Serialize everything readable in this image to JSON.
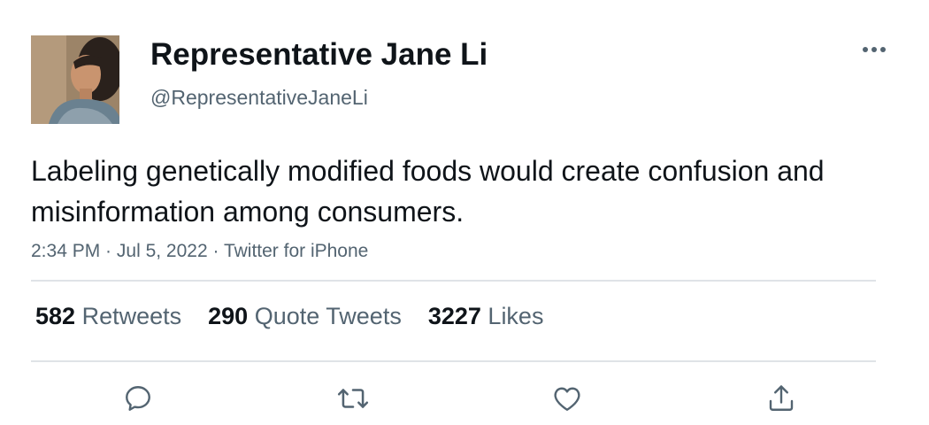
{
  "author": {
    "display_name": "Representative Jane Li",
    "handle": "@RepresentativeJaneLi"
  },
  "tweet": {
    "text": "Labeling genetically modified foods would create confusion and misinformation among consumers.",
    "time": "2:34 PM",
    "separator": " · ",
    "date": "Jul 5, 2022",
    "source": "Twitter for iPhone"
  },
  "stats": {
    "retweets": {
      "count": "582",
      "label": "Retweets"
    },
    "quote_tweets": {
      "count": "290",
      "label": "Quote Tweets"
    },
    "likes": {
      "count": "3227",
      "label": "Likes"
    }
  },
  "icons": {
    "more": "more-horizontal-icon",
    "reply": "reply-bubble-icon",
    "retweet": "retweet-arrows-icon",
    "like": "heart-icon",
    "share": "share-upload-icon"
  },
  "colors": {
    "primary_text": "#0f1419",
    "secondary_text": "#536471",
    "divider": "#dfe3e7",
    "icon": "#536471"
  }
}
